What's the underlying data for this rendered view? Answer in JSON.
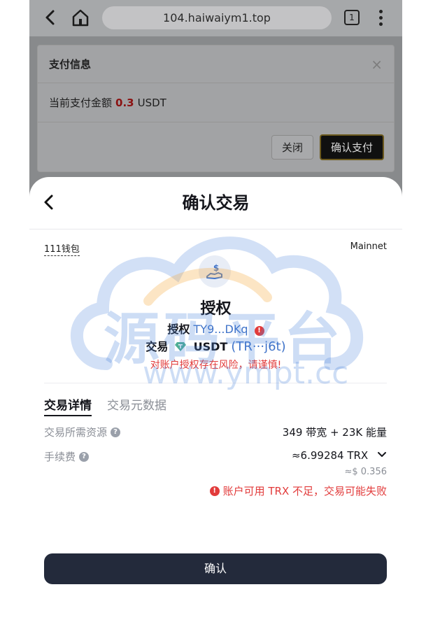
{
  "browser": {
    "url": "104.haiwaiym1.top",
    "tab_count": "1"
  },
  "pay_dialog": {
    "title": "支付信息",
    "close_symbol": "×",
    "body_prefix": "当前支付金额",
    "amount": "0.3",
    "currency": "USDT",
    "close_label": "关闭",
    "confirm_label": "确认支付"
  },
  "sheet": {
    "title": "确认交易",
    "wallet_name": "111钱包",
    "network": "Mainnet",
    "operation": "授权",
    "auth_label": "授权",
    "auth_address": "TY9...DKq",
    "trade_label": "交易",
    "token": "USDT",
    "token_address": "(TR···j6t)",
    "risk_text": "对账户授权存在风险，请谨慎!",
    "tabs": [
      "交易详情",
      "交易元数据"
    ],
    "resource_label": "交易所需资源",
    "resource_value": "349 带宽 + 23K 能量",
    "fee_label": "手续费",
    "fee_value": "≈6.99284 TRX",
    "fee_usd": "≈$ 0.356",
    "warning": "账户可用 TRX 不足，交易可能失败",
    "confirm_label": "确认"
  },
  "watermark": {
    "text": "源码平台",
    "url": "www.ympt.cc"
  },
  "colors": {
    "accent_blue": "#3f73c9",
    "danger_red": "#e23b3b",
    "confirm_button": "#232a3b"
  }
}
